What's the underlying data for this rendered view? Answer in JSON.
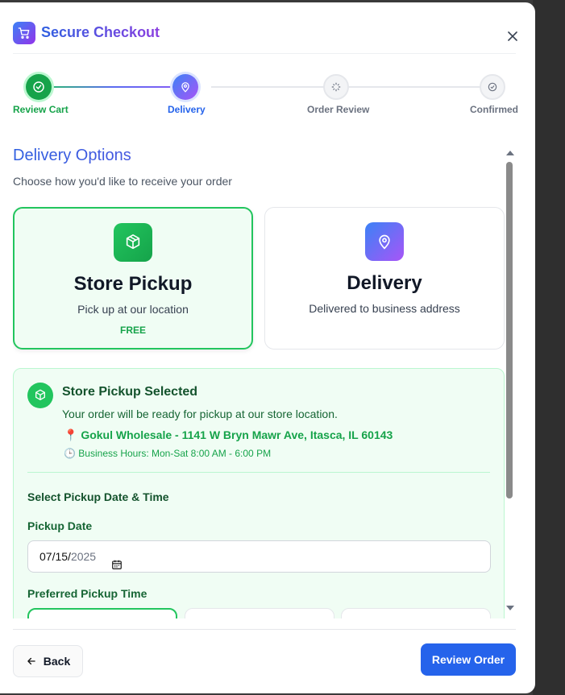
{
  "header": {
    "title": "Secure Checkout",
    "logo_icon": "cart-icon",
    "close_icon": "close-icon"
  },
  "stepper": {
    "steps": [
      {
        "label": "Review Cart",
        "state": "done",
        "icon": "check-circle-icon"
      },
      {
        "label": "Delivery",
        "state": "active",
        "icon": "map-pin-icon"
      },
      {
        "label": "Order Review",
        "state": "pending",
        "icon": "sparkle-icon"
      },
      {
        "label": "Confirmed",
        "state": "pending",
        "icon": "check-circle-icon"
      }
    ]
  },
  "delivery": {
    "title": "Delivery Options",
    "subtitle": "Choose how you'd like to receive your order",
    "options": [
      {
        "name": "Store Pickup",
        "desc": "Pick up at our location",
        "price": "FREE",
        "selected": true,
        "icon": "package-icon"
      },
      {
        "name": "Delivery",
        "desc": "Delivered to business address",
        "price": "",
        "selected": false,
        "icon": "map-pin-icon"
      }
    ]
  },
  "pickup": {
    "title": "Store Pickup Selected",
    "message": "Your order will be ready for pickup at our store location.",
    "address": "Gokul Wholesale - 1141 W Bryn Mawr Ave, Itasca, IL 60143",
    "address_icon": "📍",
    "hours": "Business Hours: Mon-Sat 8:00 AM - 6:00 PM",
    "hours_icon": "🕒",
    "select_title": "Select Pickup Date & Time",
    "date_label": "Pickup Date",
    "date_value_md": "07/15/",
    "date_value_year": "2025",
    "time_label": "Preferred Pickup Time"
  },
  "footer": {
    "back_label": "Back",
    "review_label": "Review Order"
  },
  "colors": {
    "primary": "#2563eb",
    "success": "#16a34a",
    "accent": "#8b3fe0"
  }
}
